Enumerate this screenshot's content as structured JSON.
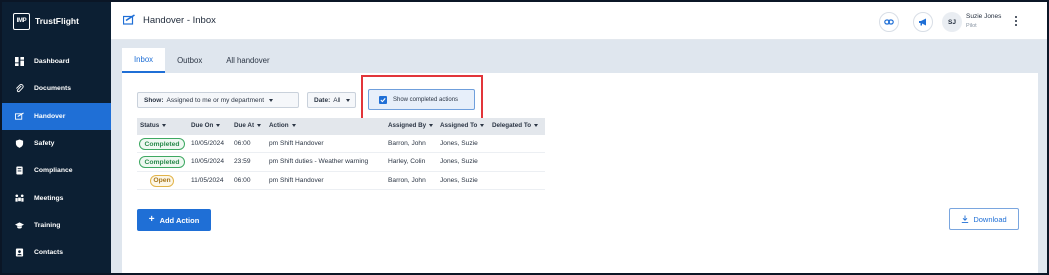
{
  "brand": {
    "logo_text": "IMP",
    "name": "TrustFlight"
  },
  "sidebar": {
    "items": [
      {
        "label": "Dashboard",
        "icon": "dashboard-icon",
        "active": false
      },
      {
        "label": "Documents",
        "icon": "paperclip-icon",
        "active": false
      },
      {
        "label": "Handover",
        "icon": "handover-icon",
        "active": true
      },
      {
        "label": "Safety",
        "icon": "shield-icon",
        "active": false
      },
      {
        "label": "Compliance",
        "icon": "compliance-icon",
        "active": false
      },
      {
        "label": "Meetings",
        "icon": "meetings-icon",
        "active": false
      },
      {
        "label": "Training",
        "icon": "graduation-cap-icon",
        "active": false
      },
      {
        "label": "Contacts",
        "icon": "contacts-icon",
        "active": false
      }
    ]
  },
  "header": {
    "title": "Handover - Inbox",
    "user": {
      "initials": "SJ",
      "name": "Suzie Jones",
      "role": "Pilot"
    }
  },
  "tabs": [
    {
      "label": "Inbox",
      "active": true
    },
    {
      "label": "Outbox",
      "active": false
    },
    {
      "label": "All handover",
      "active": false
    }
  ],
  "filters": {
    "show_label": "Show:",
    "show_value": "Assigned to me or my department",
    "date_label": "Date:",
    "date_value": "All",
    "show_completed_label": "Show completed actions",
    "show_completed_checked": true
  },
  "table": {
    "columns": [
      "Status",
      "Due On",
      "Due At",
      "Action",
      "Assigned By",
      "Assigned To",
      "Delegated To"
    ],
    "rows": [
      {
        "status": "Completed",
        "due_on": "10/05/2024",
        "due_at": "06:00",
        "action": "pm Shift Handover",
        "assigned_by": "Barron, John",
        "assigned_to": "Jones, Suzie",
        "delegated_to": ""
      },
      {
        "status": "Completed",
        "due_on": "10/05/2024",
        "due_at": "23:59",
        "action": "pm Shift duties - Weather warning",
        "assigned_by": "Harley, Colin",
        "assigned_to": "Jones, Suzie",
        "delegated_to": ""
      },
      {
        "status": "Open",
        "due_on": "11/05/2024",
        "due_at": "06:00",
        "action": "pm Shift Handover",
        "assigned_by": "Barron, John",
        "assigned_to": "Jones, Suzie",
        "delegated_to": ""
      }
    ]
  },
  "buttons": {
    "add_action": "Add Action",
    "download": "Download"
  },
  "colors": {
    "sidebar_bg": "#0c1f33",
    "accent": "#1f6fd6",
    "highlight": "#e2353a",
    "completed": "#2a8a4c",
    "open": "#a8761a"
  }
}
